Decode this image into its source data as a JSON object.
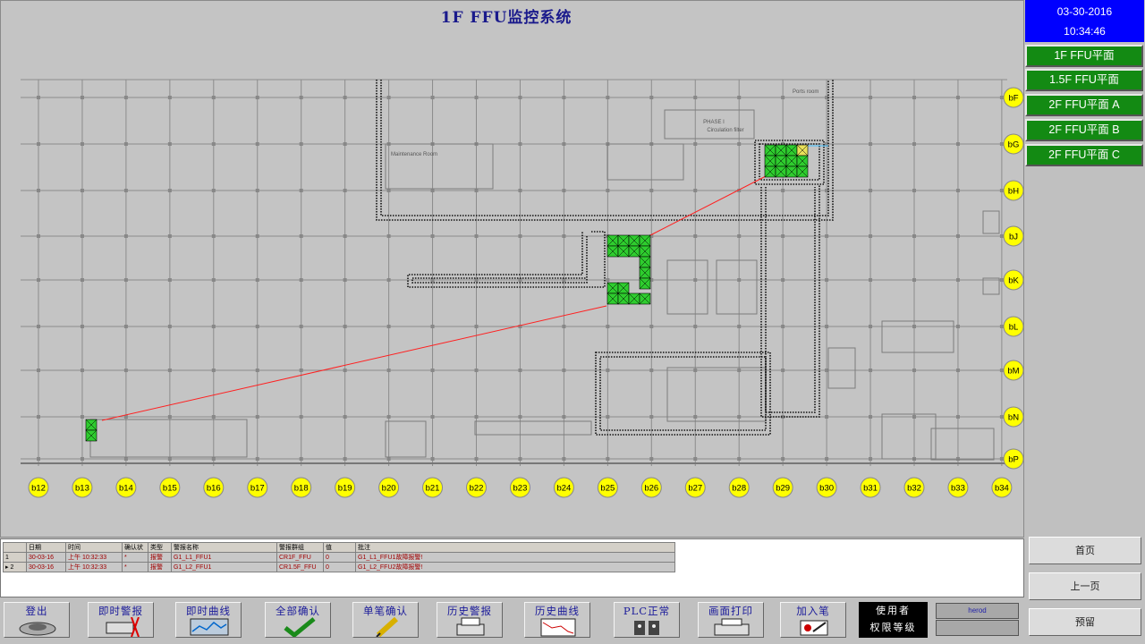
{
  "title": "1F FFU监控系统",
  "clock": {
    "date": "03-30-2016",
    "time": "10:34:46"
  },
  "floors": [
    "1F FFU平面",
    "1.5F FFU平面",
    "2F FFU平面 A",
    "2F FFU平面 B",
    "2F FFU平面 C"
  ],
  "plan": {
    "columns": [
      "b12",
      "b13",
      "b14",
      "b15",
      "b16",
      "b17",
      "b18",
      "b19",
      "b20",
      "b21",
      "b22",
      "b23",
      "b24",
      "b25",
      "b26",
      "b27",
      "b28",
      "b29",
      "b30",
      "b31",
      "b32",
      "b33",
      "b34"
    ],
    "rows": [
      "bF",
      "bG",
      "bH",
      "bJ",
      "bK",
      "bL",
      "bM",
      "bN",
      "bP"
    ],
    "room_labels": {
      "maintenance": "Maintenance Room",
      "phase": "PHASE I",
      "circulation": "Circulation filter",
      "ports": "Ports room"
    },
    "colors": {
      "unit_ok": "#2ecc2e",
      "unit_warn": "#e8e05a",
      "link": "#ff2020",
      "marker": "#ffff00"
    }
  },
  "alarm_table": {
    "headers": [
      "日期",
      "时间",
      "确认状",
      "类型",
      "警报名称",
      "警报群组",
      "值",
      "批注"
    ],
    "rows": [
      {
        "num": "1",
        "cells": [
          "30-03-16",
          "上午 10:32:33",
          "*",
          "报警",
          "G1_L1_FFU1",
          "CR1F_FFU",
          "0",
          "G1_L1_FFU1故障报警!"
        ]
      },
      {
        "num": "2",
        "cells": [
          "30-03-16",
          "上午 10:32:33",
          "*",
          "报警",
          "G1_L2_FFU1",
          "CR1.5F_FFU",
          "0",
          "G1_L2_FFU2故障报警!"
        ]
      }
    ]
  },
  "side_buttons": {
    "home": "首页",
    "prev": "上一页",
    "reserve": "预留"
  },
  "toolbar": [
    {
      "name": "logout",
      "label": "登出",
      "icon": "logout-icon"
    },
    {
      "name": "realtime-alarm",
      "label": "即时警报",
      "icon": "alarm-icon"
    },
    {
      "name": "realtime-curve",
      "label": "即时曲线",
      "icon": "curve-icon"
    },
    {
      "name": "ack-all",
      "label": "全部确认",
      "icon": "check-icon"
    },
    {
      "name": "ack-single",
      "label": "单笔确认",
      "icon": "pencil-icon"
    },
    {
      "name": "history-alarm",
      "label": "历史警报",
      "icon": "printer-icon"
    },
    {
      "name": "history-curve",
      "label": "历史曲线",
      "icon": "chart-icon"
    },
    {
      "name": "plc-status",
      "label": "PLC正常",
      "icon": "plc-icon"
    },
    {
      "name": "print-screen",
      "label": "画面打印",
      "icon": "print-icon"
    },
    {
      "name": "add-entry",
      "label": "加入笔",
      "icon": "add-icon"
    }
  ],
  "user": {
    "label": "使用者",
    "level_label": "权限等级",
    "name": "herod"
  }
}
